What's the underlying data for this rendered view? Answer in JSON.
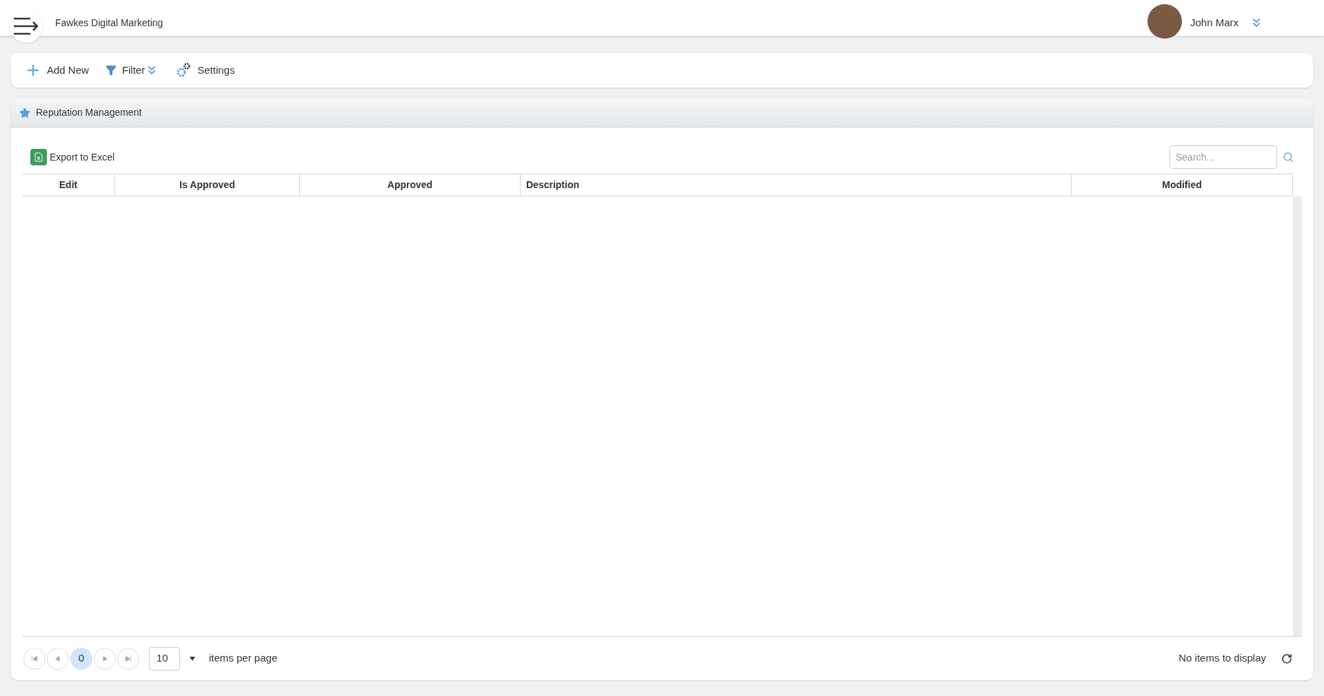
{
  "header": {
    "title": "Fawkes Digital Marketing",
    "user": "John Marx"
  },
  "toolbar": [
    {
      "kind": "add",
      "label": "Add New"
    },
    {
      "kind": "filter",
      "label": "Filter"
    },
    {
      "kind": "settings",
      "label": "Settings"
    }
  ],
  "panel": {
    "title": "Reputation Management",
    "export": "Export to Excel",
    "search": {
      "placeholder": "Search..."
    },
    "columns": [
      {
        "label": "Edit"
      },
      {
        "label": "Is Approved"
      },
      {
        "label": "Approved"
      },
      {
        "label": "Description"
      },
      {
        "label": "Modified"
      }
    ],
    "pager": {
      "pages": [
        {
          "label": "0",
          "selected": true
        }
      ],
      "page_size": "10",
      "page_size_label": "items per page",
      "status": "No items to display"
    }
  }
}
